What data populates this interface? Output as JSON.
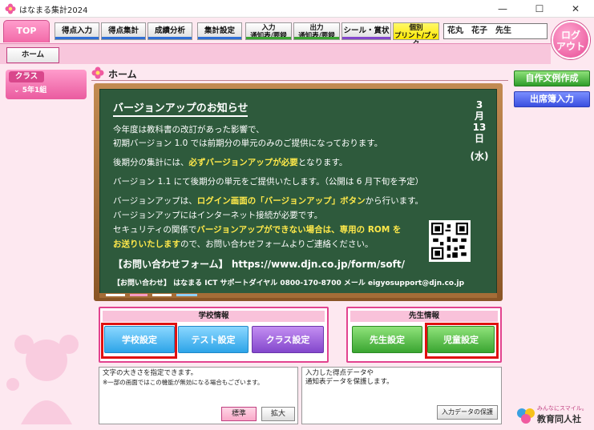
{
  "window": {
    "title": "はなまる集計2024",
    "minimize": "—",
    "maximize": "☐",
    "close": "✕"
  },
  "nav": {
    "top": "TOP",
    "buttons": [
      {
        "label": "得点入力",
        "color": "#2f6fd6"
      },
      {
        "label": "得点集計",
        "color": "#2f6fd6"
      },
      {
        "label": "成績分析",
        "color": "#2f6fd6"
      },
      {
        "label": "集計設定",
        "color": "#2f6fd6"
      }
    ],
    "two_line": [
      {
        "line1": "入力",
        "line2": "通知表/要録",
        "color": "#3aa531"
      },
      {
        "line1": "出力",
        "line2": "通知表/要録",
        "color": "#3aa531"
      }
    ],
    "seal": {
      "label": "シール・賞状",
      "color": "#8347cc"
    },
    "print": {
      "line1": "個別",
      "line2": "プリント/ブック"
    },
    "user": "花丸　花子　先生",
    "logout_line1": "ログ",
    "logout_line2": "アウト",
    "home_sub": "ホーム"
  },
  "sidebar": {
    "class_header": "クラス",
    "class_item": "5年1組"
  },
  "page_title": "ホーム",
  "board": {
    "title": "バージョンアップのお知らせ",
    "date": [
      "3",
      "月",
      "13",
      "日",
      "(水)"
    ],
    "l1": "今年度は教科書の改訂があった影響で、",
    "l2": "初期バージョン 1.0 では前期分の単元のみのご提供になっております。",
    "l3a": "後期分の集計には、",
    "l3b": "必ずバージョンアップが必要",
    "l3c": "となります。",
    "l4": "バージョン 1.1 にて後期分の単元をご提供いたします。（公開は 6 月下旬を予定）",
    "l5a": "バージョンアップは、",
    "l5b": "ログイン画面の「バージョンアップ」ボタン",
    "l5c": "から行います。",
    "l6": "バージョンアップにはインターネット接続が必要です。",
    "l7a": "セキュリティの関係で",
    "l7b": "バージョンアップができない場合は、専用の ROM を",
    "l8a": "お送りいたします",
    "l8b": "ので、お問い合わせフォームよりご連絡ください。",
    "form": "【お問い合わせフォーム】 https://www.djn.co.jp/form/soft/",
    "contact": "【お問い合わせ】 はなまる ICT サポートダイヤル  0800-170-8700   メール  eigyosupport@djn.co.jp"
  },
  "school_panel": {
    "title": "学校情報",
    "buttons": [
      "学校設定",
      "テスト設定",
      "クラス設定"
    ]
  },
  "teacher_panel": {
    "title": "先生情報",
    "buttons": [
      "先生設定",
      "児童設定"
    ]
  },
  "font_box": {
    "line1": "文字の大きさを指定できます。",
    "line2": "※一部の画面ではこの機能が無効になる場合もございます。",
    "normal": "標準",
    "large": "拡大"
  },
  "backup_box": {
    "line1": "入力した得点データや",
    "line2": "通知表データを保護します。",
    "button": "入力データの保護"
  },
  "right": {
    "btn1": "自作文例作成",
    "btn2": "出席簿入力"
  },
  "brand": {
    "slogan": "みんなにスマイル。",
    "name": "教育同人社"
  }
}
